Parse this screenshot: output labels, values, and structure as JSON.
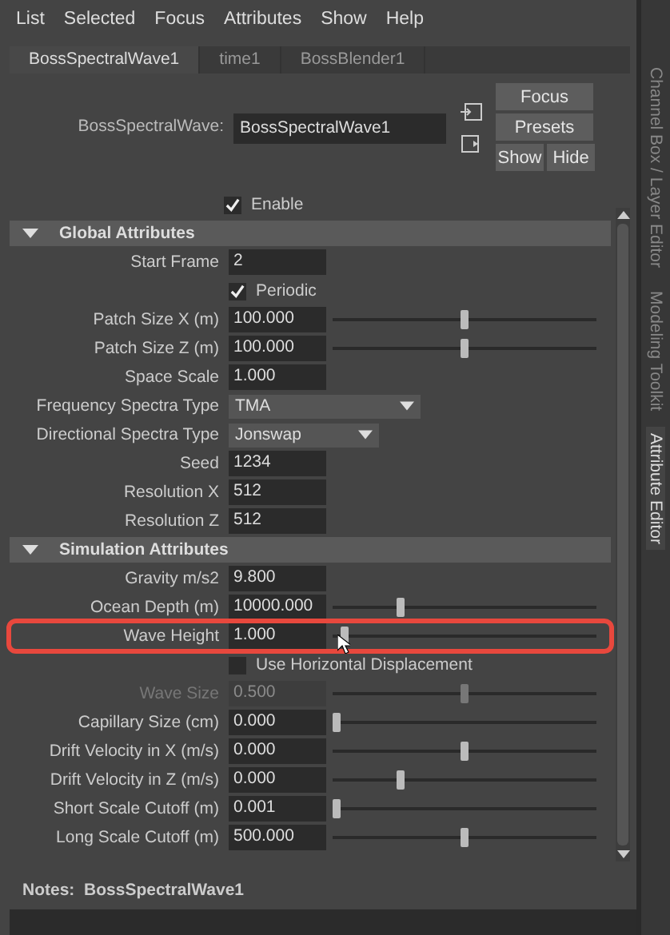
{
  "menu": [
    "List",
    "Selected",
    "Focus",
    "Attributes",
    "Show",
    "Help"
  ],
  "tabs": [
    {
      "label": "BossSpectralWave1",
      "selected": true
    },
    {
      "label": "time1",
      "selected": false
    },
    {
      "label": "BossBlender1",
      "selected": false
    }
  ],
  "node": {
    "label": "BossSpectralWave:",
    "value": "BossSpectralWave1"
  },
  "buttons": {
    "focus": "Focus",
    "presets": "Presets",
    "show": "Show",
    "hide": "Hide"
  },
  "enable": {
    "label": "Enable",
    "checked": true
  },
  "sections": [
    {
      "title": "Global Attributes",
      "expanded": true,
      "rows": [
        {
          "kind": "field",
          "label": "Start Frame",
          "value": "2"
        },
        {
          "kind": "checkbox",
          "label": "Periodic",
          "checked": true
        },
        {
          "kind": "slider",
          "label": "Patch Size X (m)",
          "value": "100.000",
          "level": 0.5
        },
        {
          "kind": "slider",
          "label": "Patch Size Z (m)",
          "value": "100.000",
          "level": 0.5
        },
        {
          "kind": "field",
          "label": "Space Scale",
          "value": "1.000"
        },
        {
          "kind": "dropdown",
          "label": "Frequency Spectra Type",
          "value": "TMA"
        },
        {
          "kind": "dropdown",
          "label": "Directional Spectra Type",
          "value": "Jonswap"
        },
        {
          "kind": "field",
          "label": "Seed",
          "value": "1234"
        },
        {
          "kind": "field",
          "label": "Resolution X",
          "value": "512"
        },
        {
          "kind": "field",
          "label": "Resolution Z",
          "value": "512"
        }
      ]
    },
    {
      "title": "Simulation Attributes",
      "expanded": true,
      "rows": [
        {
          "kind": "field",
          "label": "Gravity m/s2",
          "value": "9.800"
        },
        {
          "kind": "slider",
          "label": "Ocean Depth (m)",
          "value": "10000.000",
          "level": 0.25
        },
        {
          "kind": "slider",
          "label": "Wave Height",
          "value": "1.000",
          "level": 0.03,
          "highlighted": true
        },
        {
          "kind": "checkbox",
          "label": "Use Horizontal Displacement",
          "checked": false
        },
        {
          "kind": "slider",
          "label": "Wave Size",
          "value": "0.500",
          "level": 0.5,
          "disabled": true
        },
        {
          "kind": "slider",
          "label": "Capillary Size (cm)",
          "value": "0.000",
          "level": 0
        },
        {
          "kind": "slider",
          "label": "Drift Velocity in X (m/s)",
          "value": "0.000",
          "level": 0.5
        },
        {
          "kind": "slider",
          "label": "Drift Velocity in Z (m/s)",
          "value": "0.000",
          "level": 0.25
        },
        {
          "kind": "slider",
          "label": "Short Scale Cutoff (m)",
          "value": "0.001",
          "level": 0
        },
        {
          "kind": "slider",
          "label": "Long Scale Cutoff (m)",
          "value": "500.000",
          "level": 0.5
        }
      ]
    }
  ],
  "notes": {
    "label": "Notes:",
    "value": "BossSpectralWave1"
  },
  "side_tabs": [
    {
      "label": "Channel Box / Layer Editor",
      "selected": false
    },
    {
      "label": "Modeling Toolkit",
      "selected": false
    },
    {
      "label": "Attribute Editor",
      "selected": true
    }
  ]
}
